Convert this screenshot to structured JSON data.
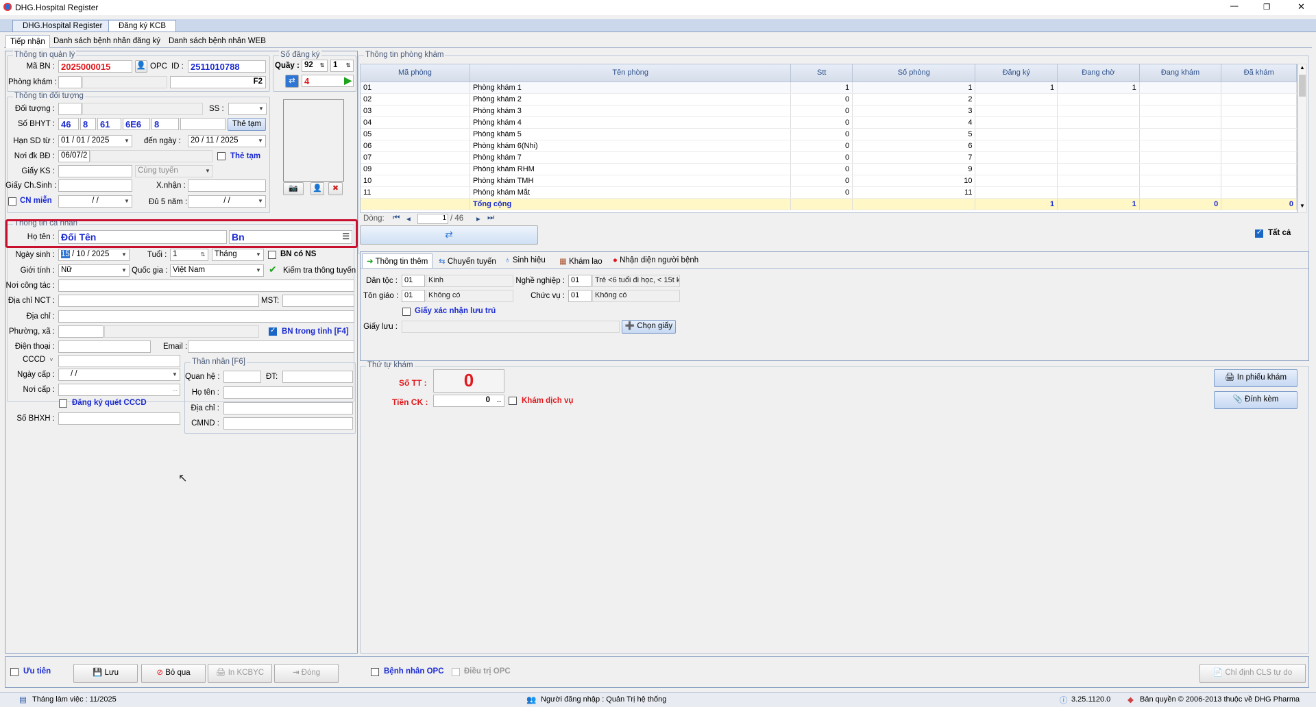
{
  "window": {
    "title": "DHG.Hospital Register",
    "minimize": "—",
    "maximize": "❐",
    "close": "✕"
  },
  "doc_tabs": [
    "DHG.Hospital Register",
    "Đăng ký KCB"
  ],
  "sub_tabs": [
    "Tiếp nhận",
    "Danh sách bệnh nhân đăng ký",
    "Danh sách bệnh nhân WEB"
  ],
  "quanly": {
    "title": "Thông tin quản lý",
    "ma_bn_label": "Mã BN :",
    "ma_bn": "2025000015",
    "opc_label": "OPC",
    "id_label": "ID :",
    "id": "2511010788",
    "phong_kham_label": "Phòng khám :",
    "f2": "F2"
  },
  "sodangky": {
    "title": "Số đăng ký",
    "quay_label": "Quầy :",
    "quay": "92",
    "quay2": "1",
    "count": "4"
  },
  "doituong": {
    "title": "Thông tin đối tượng",
    "doi_tuong_label": "Đối tượng :",
    "ss_label": "SS :",
    "so_bhyt_label": "Số BHYT :",
    "bhyt": [
      "46",
      "8",
      "61",
      "6E6",
      "8"
    ],
    "the_tam_button": "Thẻ tạm",
    "han_sd_label": "Hạn SD từ :",
    "han_tu": "01 / 01 / 2025",
    "den_ngay_label": "đến ngày :",
    "han_den": "20 / 11 / 2025",
    "noi_dk_label": "Nơi đk BĐ :",
    "noi_dk": "06/07/2",
    "the_tam_check": "Thẻ tạm",
    "giay_ks_label": "Giấy KS :",
    "cung_tuyen": "Cùng tuyến",
    "giay_chsinh_label": "Giấy Ch.Sinh :",
    "xnhan_label": "X.nhận :",
    "cn_mien_label": "CN miễn",
    "date_empty": "/     /",
    "du5nam_label": "Đủ 5 năm :"
  },
  "canhan": {
    "title": "Thông tin cá nhân",
    "ho_ten_label": "Họ tên :",
    "ho_ten": "Đối Tên",
    "ten_goi": "Bn",
    "ngay_sinh_label": "Ngày sinh :",
    "ngay_sinh_day": "15",
    "ngay_sinh_rest": "/ 10 / 2025",
    "tuoi_label": "Tuổi :",
    "tuoi": "1",
    "tuoi_unit": "Tháng",
    "bn_co_ns": "BN có NS",
    "gioi_tinh_label": "Giới tính :",
    "gioi_tinh": "Nữ",
    "quoc_gia_label": "Quốc gia :",
    "quoc_gia": "Việt Nam",
    "kiem_tra": "Kiểm tra thông tuyến",
    "noi_cong_tac_label": "Nơi công tác :",
    "dia_chi_nct_label": "Địa chỉ  NCT :",
    "mst_label": "MST:",
    "dia_chi_label": "Địa chỉ :",
    "phuong_xa_label": "Phường, xã :",
    "bn_trong_tinh": "BN trong tỉnh [F4]",
    "dien_thoai_label": "Điện thoại :",
    "email_label": "Email :",
    "cccd_label": "CCCD",
    "ngay_cap_label": "Ngày cấp :",
    "noi_cap_label": "Nơi cấp :",
    "dang_ky_quet": "Đăng ký quét CCCD",
    "so_bhxh_label": "Số BHXH :"
  },
  "thannhan": {
    "title": "Thân nhân [F6]",
    "quan_he_label": "Quan hệ :",
    "dt_label": "ĐT:",
    "ho_ten_label": "Họ tên :",
    "dia_chi_label": "Địa chỉ :",
    "cmnd_label": "CMND :"
  },
  "phongkham": {
    "title": "Thông tin phòng khám",
    "columns": [
      "Mã phòng",
      "Tên phòng",
      "Stt",
      "Số phòng",
      "Đăng ký",
      "Đang chờ",
      "Đang khám",
      "Đã khám"
    ],
    "rows": [
      [
        "01",
        "Phòng khám 1",
        "1",
        "1",
        "1",
        "1",
        "",
        ""
      ],
      [
        "02",
        "Phòng khám 2",
        "0",
        "2",
        "",
        "",
        "",
        ""
      ],
      [
        "03",
        "Phòng khám 3",
        "0",
        "3",
        "",
        "",
        "",
        ""
      ],
      [
        "04",
        "Phòng khám 4",
        "0",
        "4",
        "",
        "",
        "",
        ""
      ],
      [
        "05",
        "Phòng khám 5",
        "0",
        "5",
        "",
        "",
        "",
        ""
      ],
      [
        "06",
        "Phòng khám 6(Nhi)",
        "0",
        "6",
        "",
        "",
        "",
        ""
      ],
      [
        "07",
        "Phòng khám 7",
        "0",
        "7",
        "",
        "",
        "",
        ""
      ],
      [
        "09",
        "Phòng khám RHM",
        "0",
        "9",
        "",
        "",
        "",
        ""
      ],
      [
        "10",
        "Phòng khám TMH",
        "0",
        "10",
        "",
        "",
        "",
        ""
      ],
      [
        "11",
        "Phòng khám Mắt",
        "0",
        "11",
        "",
        "",
        "",
        ""
      ]
    ],
    "total": [
      "",
      "Tổng cộng",
      "",
      "",
      "1",
      "1",
      "0",
      "0"
    ],
    "nav_label": "Dòng:",
    "page": "1",
    "page_total": "/ 46",
    "tat_ca": "Tất cả"
  },
  "thongtin_tabs": [
    "Thông tin thêm",
    "Chuyển tuyến",
    "Sinh hiệu",
    "Khám lao",
    "Nhận diện người bệnh"
  ],
  "thongtin": {
    "dan_toc_label": "Dân tộc :",
    "dan_toc_code": "01",
    "dan_toc": "Kinh",
    "nghe_nghiep_label": "Nghề nghiệp :",
    "nghe_code": "01",
    "nghe": "Trẻ <6 tuổi đi học, < 15t k",
    "ton_giao_label": "Tôn giáo :",
    "ton_giao_code": "01",
    "ton_giao": "Không có",
    "chuc_vu_label": "Chức vụ :",
    "chuc_vu_code": "01",
    "chuc_vu": "Không có",
    "giay_xac_nhan": "Giấy xác nhận lưu trú",
    "giay_luu_label": "Giấy lưu :",
    "chon_giay": "Chọn giấy"
  },
  "thutu": {
    "title": "Thứ tự khám",
    "so_tt_label": "Số TT :",
    "so_tt": "0",
    "tien_ck_label": "Tiền CK :",
    "tien_ck": "0",
    "kham_dich_vu": "Khám dịch vụ",
    "in_phieu": "In phiếu khám",
    "dinh_kem": "Đính kèm"
  },
  "footer": {
    "uu_tien": "Ưu tiên",
    "luu": "Lưu",
    "bo_qua": "Bỏ qua",
    "in_kcbyc": "In KCBYC",
    "dong": "Đóng",
    "bn_opc": "Bệnh nhân OPC",
    "dieu_tri_opc": "Điều trị OPC",
    "chi_dinh": "Chỉ định CLS tự do"
  },
  "status": {
    "thang": "Tháng làm việc : 11/2025",
    "nguoi_dang_nhap": "Người đăng nhập : Quản Trị hệ thống",
    "version": "3.25.1120.0",
    "ban_quyen": "Bản quyền © 2006-2013 thuộc về DHG Pharma"
  },
  "colors": {
    "accent": "#1b2bd1",
    "red": "#e0191e",
    "highlight_box": "#c8102e"
  }
}
